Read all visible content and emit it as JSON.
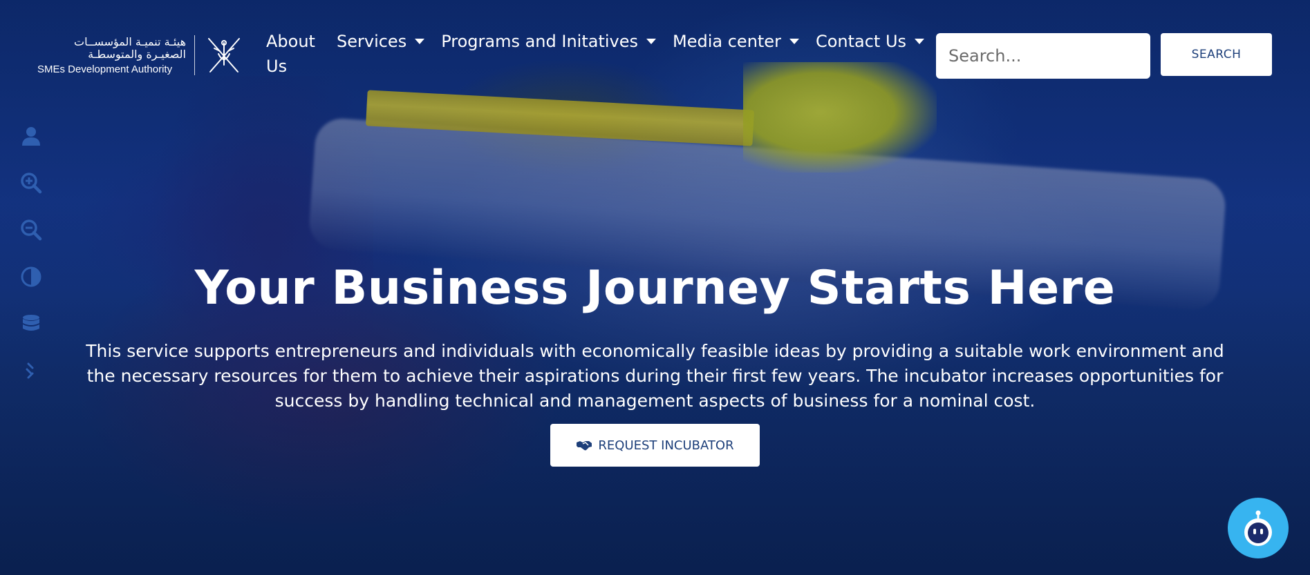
{
  "logo": {
    "arabic_line1": "هيئـة تنميـة المؤسســات",
    "arabic_line2": "الصغيـرة والمتوسطـة",
    "english": "SMEs Development Authority",
    "emblem_icon": "oman-emblem-icon"
  },
  "nav": {
    "items": [
      {
        "label": "About Us",
        "has_dropdown": false
      },
      {
        "label": "Services",
        "has_dropdown": true
      },
      {
        "label": "Programs and Initatives",
        "has_dropdown": true
      },
      {
        "label": "Media center",
        "has_dropdown": true
      },
      {
        "label": "Contact Us",
        "has_dropdown": true
      }
    ]
  },
  "search": {
    "placeholder": "Search...",
    "button_label": "SEARCH"
  },
  "accessibility_tools": [
    {
      "icon": "user-icon"
    },
    {
      "icon": "zoom-in-icon"
    },
    {
      "icon": "zoom-out-icon"
    },
    {
      "icon": "contrast-icon"
    },
    {
      "icon": "database-icon"
    },
    {
      "icon": "link-icon"
    }
  ],
  "hero": {
    "title": "Your Business Journey Starts Here",
    "description": "This service supports entrepreneurs and individuals with economically feasible ideas by providing a suitable work environment and the necessary resources for them to achieve their aspirations during their first few years. The incubator increases opportunities for success by handling technical and management aspects of business for a nominal cost.",
    "cta_label": "REQUEST INCUBATOR",
    "cta_icon": "handshake-icon"
  },
  "chatbot": {
    "icon": "robot-icon"
  },
  "colors": {
    "brand_blue": "#1d3f7a",
    "chatbot_bg": "#37b4f0",
    "sidebar_icon": "#2f5fb0"
  }
}
